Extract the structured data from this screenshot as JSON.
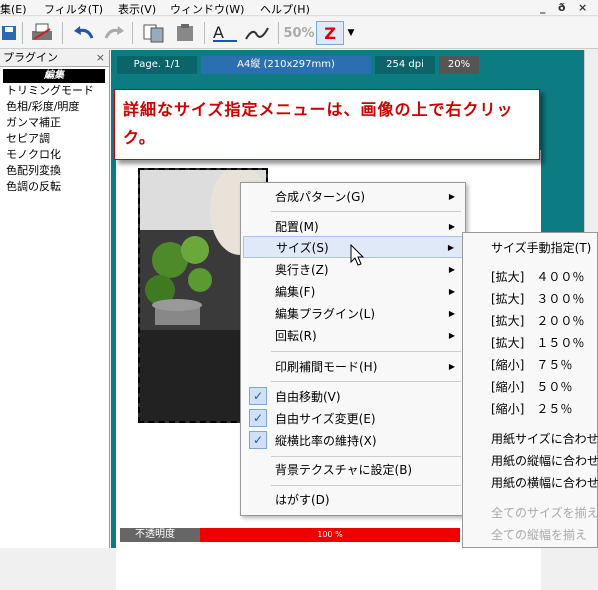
{
  "menubar": {
    "items": [
      "集(E)",
      "フィルタ(T)",
      "表示(V)",
      "ウィンドウ(W)",
      "ヘルプ(H)"
    ],
    "window_controls": [
      "_",
      "ð",
      "×"
    ]
  },
  "toolbar": {
    "zoom_label": "50%",
    "active_label": "Z"
  },
  "sidebar": {
    "title": "プラグイン",
    "close": "×",
    "selected": "編集",
    "items": [
      "トリミングモード",
      "色相/彩度/明度",
      "ガンマ補正",
      "セピア調",
      "モノクロ化",
      "色配列変換",
      "色調の反転"
    ]
  },
  "infobar": {
    "page": "Page. 1/1",
    "paper": "A4縦 (210x297mm)",
    "dpi": "254 dpi",
    "zoom": "20%"
  },
  "tooltip": {
    "text": "詳細なサイズ指定メニューは、画像の上で右クリック。"
  },
  "opacity": {
    "label": "不透明度",
    "value": "100 %",
    "percent": 100
  },
  "context_menu": {
    "items": [
      {
        "label": "合成パターン(G)",
        "sub": true
      },
      {
        "label": "配置(M)",
        "sub": true
      },
      {
        "label": "サイズ(S)",
        "sub": true,
        "highlighted": true
      },
      {
        "label": "奥行き(Z)",
        "sub": true
      },
      {
        "label": "編集(F)",
        "sub": true
      },
      {
        "label": "編集プラグイン(L)",
        "sub": true
      },
      {
        "label": "回転(R)",
        "sub": true
      },
      {
        "label": "印刷補間モード(H)",
        "sub": true
      },
      {
        "label": "自由移動(V)",
        "checked": true
      },
      {
        "label": "自由サイズ変更(E)",
        "checked": true
      },
      {
        "label": "縦横比率の維持(X)",
        "checked": true
      },
      {
        "label": "背景テクスチャに設定(B)"
      },
      {
        "label": "はがす(D)"
      }
    ]
  },
  "submenu": {
    "items": [
      {
        "label": "サイズ手動指定(T)"
      },
      {
        "label": "[拡大]　４００％"
      },
      {
        "label": "[拡大]　３００％"
      },
      {
        "label": "[拡大]　２００％"
      },
      {
        "label": "[拡大]　１５０％"
      },
      {
        "label": "[縮小]　７５％"
      },
      {
        "label": "[縮小]　５０％"
      },
      {
        "label": "[縮小]　２５％"
      },
      {
        "label": "用紙サイズに合わせ"
      },
      {
        "label": "用紙の縦幅に合わせ"
      },
      {
        "label": "用紙の横幅に合わせ"
      },
      {
        "label": "全てのサイズを揃え",
        "disabled": true
      },
      {
        "label": "全ての縦幅を揃え",
        "disabled": true
      }
    ]
  }
}
